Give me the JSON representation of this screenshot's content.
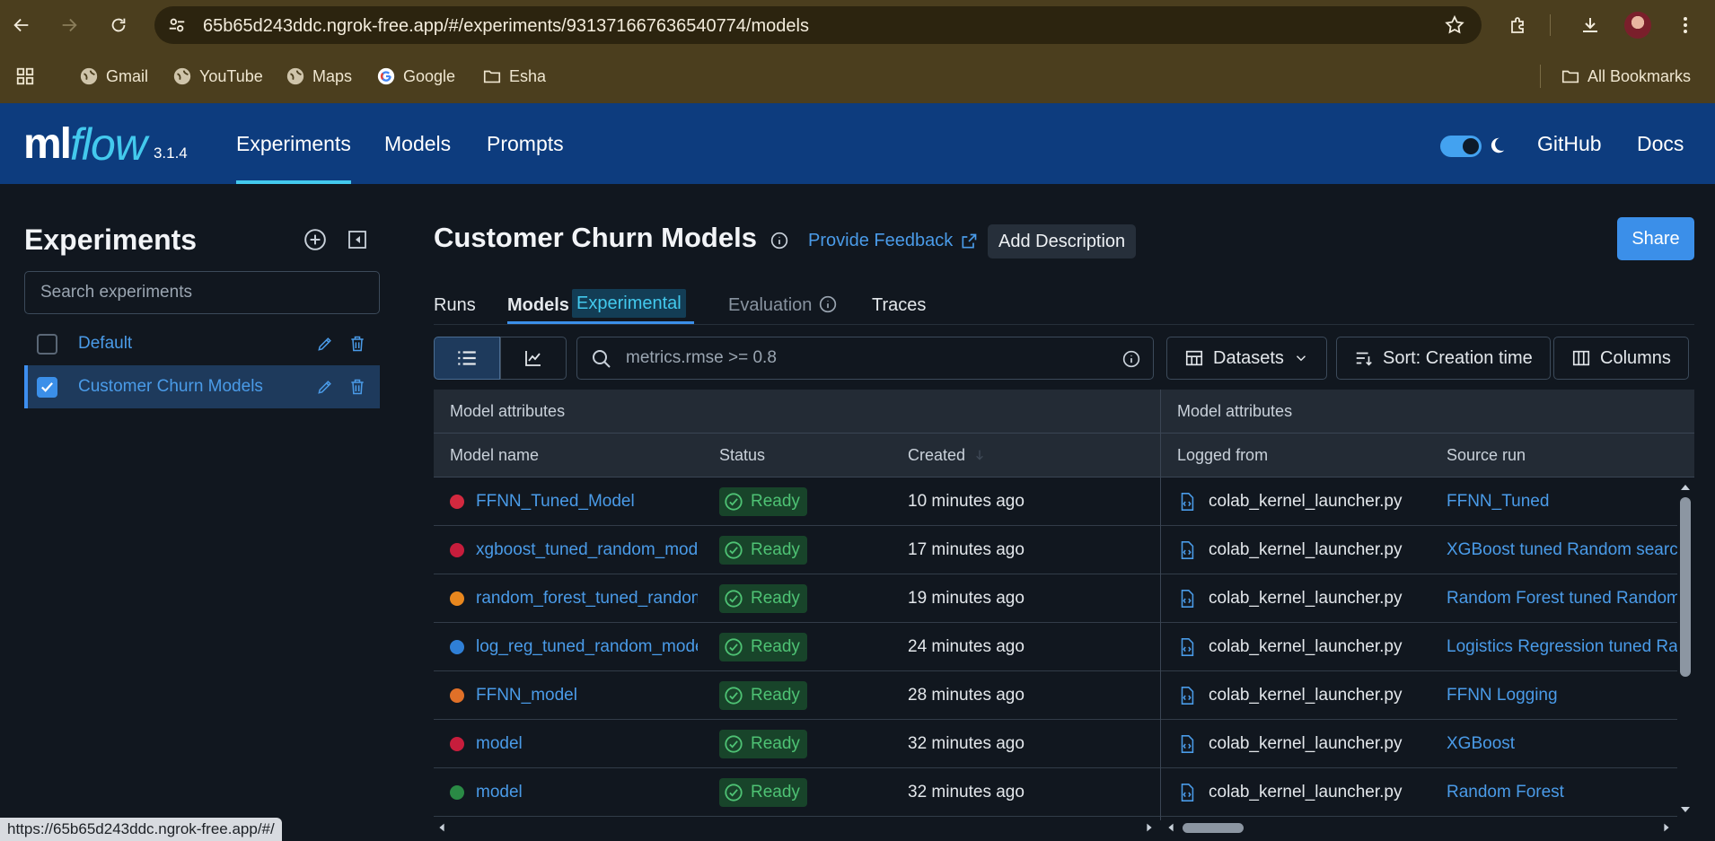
{
  "browser": {
    "url": "65b65d243ddc.ngrok-free.app/#/experiments/931371667636540774/models",
    "bookmarks": [
      {
        "label": "Gmail",
        "icon": "globe-icon"
      },
      {
        "label": "YouTube",
        "icon": "globe-icon"
      },
      {
        "label": "Maps",
        "icon": "globe-icon"
      },
      {
        "label": "Google",
        "icon": "google-icon"
      },
      {
        "label": "Esha",
        "icon": "folder-icon"
      }
    ],
    "all_bookmarks": "All Bookmarks",
    "status_url": "https://65b65d243ddc.ngrok-free.app/#/"
  },
  "app": {
    "logo_ml": "ml",
    "logo_flow": "flow",
    "version": "3.1.4",
    "nav": [
      "Experiments",
      "Models",
      "Prompts"
    ],
    "github": "GitHub",
    "docs": "Docs",
    "accent": "#43c9ed",
    "header_bg": "#0d3c7e"
  },
  "sidebar": {
    "title": "Experiments",
    "search_placeholder": "Search experiments",
    "experiments": [
      {
        "name": "Default",
        "checked": false
      },
      {
        "name": "Customer Churn Models",
        "checked": true
      }
    ]
  },
  "main": {
    "title": "Customer Churn Models",
    "feedback": "Provide Feedback",
    "add_description": "Add Description",
    "share": "Share",
    "tabs": {
      "runs": "Runs",
      "models": "Models",
      "experimental": "Experimental",
      "evaluation": "Evaluation",
      "traces": "Traces"
    },
    "filter_value": "metrics.rmse >= 0.8",
    "datasets": "Datasets",
    "sort": "Sort: Creation time",
    "columns": "Columns"
  },
  "table": {
    "group_left": "Model attributes",
    "group_right": "Model attributes",
    "headers": {
      "name": "Model name",
      "status": "Status",
      "created": "Created",
      "logged_from": "Logged from",
      "source_run": "Source run"
    },
    "rows": [
      {
        "color": "#d3293f",
        "name": "FFNN_Tuned_Model",
        "status": "Ready",
        "created": "10 minutes ago",
        "logged_from": "colab_kernel_launcher.py",
        "source_run": "FFNN_Tuned"
      },
      {
        "color": "#c71d3c",
        "name": "xgboost_tuned_random_models",
        "status": "Ready",
        "created": "17 minutes ago",
        "logged_from": "colab_kernel_launcher.py",
        "source_run": "XGBoost tuned Random search"
      },
      {
        "color": "#e8871e",
        "name": "random_forest_tuned_random_models",
        "status": "Ready",
        "created": "19 minutes ago",
        "logged_from": "colab_kernel_launcher.py",
        "source_run": "Random Forest tuned Random search"
      },
      {
        "color": "#2f7fd6",
        "name": "log_reg_tuned_random_models",
        "status": "Ready",
        "created": "24 minutes ago",
        "logged_from": "colab_kernel_launcher.py",
        "source_run": "Logistics Regression tuned Random search"
      },
      {
        "color": "#e07028",
        "name": "FFNN_model",
        "status": "Ready",
        "created": "28 minutes ago",
        "logged_from": "colab_kernel_launcher.py",
        "source_run": "FFNN Logging"
      },
      {
        "color": "#c71d3c",
        "name": "model",
        "status": "Ready",
        "created": "32 minutes ago",
        "logged_from": "colab_kernel_launcher.py",
        "source_run": "XGBoost"
      },
      {
        "color": "#2a8a45",
        "name": "model",
        "status": "Ready",
        "created": "32 minutes ago",
        "logged_from": "colab_kernel_launcher.py",
        "source_run": "Random Forest"
      }
    ]
  }
}
